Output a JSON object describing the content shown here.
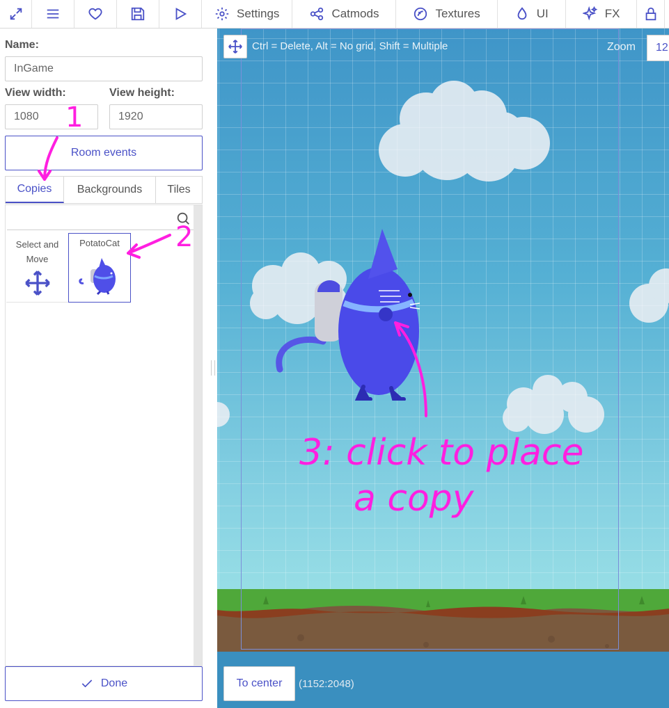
{
  "toolbar": {
    "settings": "Settings",
    "catmods": "Catmods",
    "textures": "Textures",
    "ui": "UI",
    "fx": "FX"
  },
  "room": {
    "name_label": "Name:",
    "name_value": "InGame",
    "width_label": "View width:",
    "width_value": "1080",
    "height_label": "View height:",
    "height_value": "1920",
    "events_button": "Room events"
  },
  "tabs": [
    "Copies",
    "Backgrounds",
    "Tiles"
  ],
  "copies": [
    {
      "label": "Select and Move"
    },
    {
      "label": "PotatoCat"
    }
  ],
  "done_button": "Done",
  "canvas": {
    "hint": "Ctrl = Delete, Alt = No grid, Shift = Multiple",
    "zoom_label": "Zoom",
    "zoom_value": "12",
    "center_button": "To center",
    "coords": "(1152:2048)"
  },
  "annotations": {
    "step1": "1",
    "step2": "2",
    "step3_line1": "3:  click to place",
    "step3_line2": "a copy"
  },
  "colors": {
    "accent": "#4a51c7",
    "annotation": "#ff1fe0"
  }
}
